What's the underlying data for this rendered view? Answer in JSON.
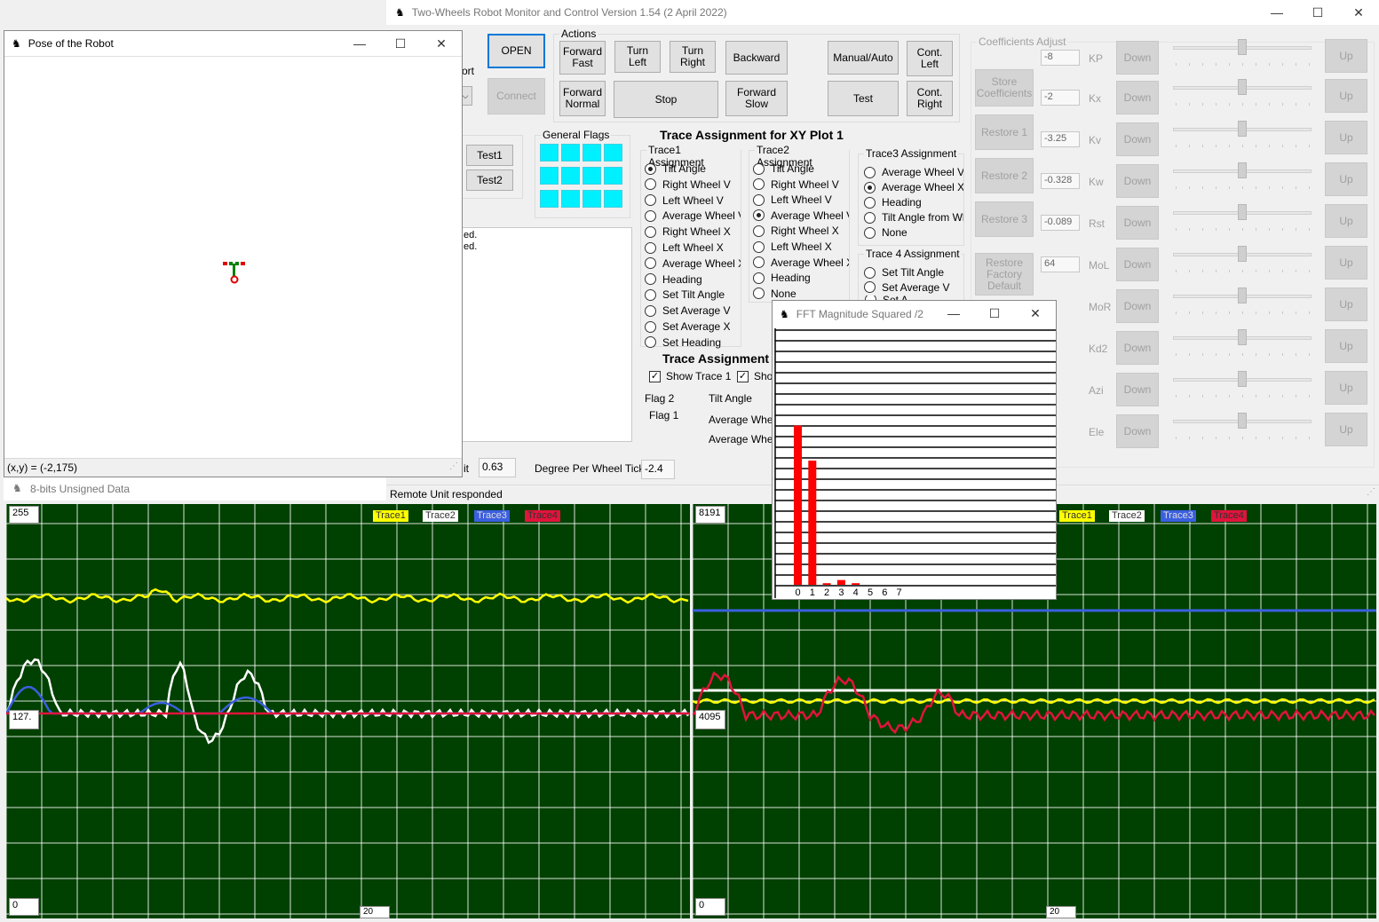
{
  "main_window": {
    "title": "Two-Wheels Robot Monitor and Control Version 1.54 (2 April 2022)",
    "open_label": "OPEN",
    "connect_label": "Connect",
    "port_label": "ort",
    "actions_label": "Actions",
    "actions": {
      "forward_fast": "Forward\nFast",
      "turn_left": "Turn\nLeft",
      "turn_right": "Turn\nRight",
      "backward": "Backward",
      "forward_normal": "Forward\nNormal",
      "stop": "Stop",
      "forward_slow": "Forward\nSlow",
      "manual_auto": "Manual/Auto",
      "cont_left": "Cont.\nLeft",
      "test": "Test",
      "cont_right": "Cont.\nRight"
    },
    "test1": "Test1",
    "test2": "Test2",
    "general_flags": "General Flags",
    "trace_xy_title": "Trace Assignment for XY Plot 1",
    "trace1_title": "Trace1 Assignment",
    "trace1_options": [
      "Tilt Angle",
      "Right Wheel V",
      "Left Wheel V",
      "Average Wheel V",
      "Right Wheel X",
      "Left Wheel X",
      "Average Wheel X",
      "Heading",
      "Set Tilt Angle",
      "Set Average V",
      "Set Average X",
      "Set Heading"
    ],
    "trace2_title": "Trace2 Assignment",
    "trace2_options": [
      "Tilt Angle",
      "Right Wheel V",
      "Left Wheel V",
      "Average Wheel V",
      "Right Wheel X",
      "Left Wheel X",
      "Average Wheel X",
      "Heading",
      "None"
    ],
    "trace3_title": "Trace3 Assignment",
    "trace3_options": [
      "Average Wheel V",
      "Average Wheel X",
      "Heading",
      "Tilt Angle from Whe",
      "None"
    ],
    "trace4_title": "Trace 4 Assignment",
    "trace4_options": [
      "Set Tilt Angle",
      "Set Average V"
    ],
    "trace4_cut": "Set A",
    "trace_assign2_title": "Trace Assignment",
    "show_trace1": "Show Trace 1",
    "show_trace2": "Show",
    "flag2": "Flag 2",
    "flag1": "Flag 1",
    "flag_tilt": "Tilt Angle",
    "flag_avg1": "Average Whee",
    "flag_avg2": "Average Whee",
    "log_line1": "ed.",
    "log_line2": "ed.",
    "hit_label": "it",
    "hit_value": "0.63",
    "degree_label": "Degree Per Wheel Tick",
    "degree_value": "-2.4",
    "status": "Remote Unit responded",
    "coef_title": "Coefficients Adjust",
    "store": "Store\nCoefficients",
    "restore1": "Restore 1",
    "restore2": "Restore 2",
    "restore3": "Restore 3",
    "restore_factory": "Restore\nFactory\nDefault",
    "down": "Down",
    "up": "Up",
    "coeffs": [
      {
        "value": "-8",
        "name": "KP"
      },
      {
        "value": "-2",
        "name": "Kx"
      },
      {
        "value": "-3.25",
        "name": "Kv"
      },
      {
        "value": "-0.328",
        "name": "Kw"
      },
      {
        "value": "-0.089",
        "name": "Rst"
      },
      {
        "value": "64",
        "name": "MoL"
      },
      {
        "value": "",
        "name": "MoR"
      },
      {
        "value": "",
        "name": "Kd2"
      },
      {
        "value": "",
        "name": "Azi"
      },
      {
        "value": "",
        "name": "Ele"
      }
    ]
  },
  "pose_window": {
    "title": "Pose of the Robot",
    "coords": "(x,y) = (-2,175)"
  },
  "data_window": {
    "title": "8-bits Unsigned Data"
  },
  "plot_left": {
    "top": "255",
    "mid": "127.",
    "bottom": "0",
    "x_end": "20"
  },
  "plot_right": {
    "top": "8191",
    "mid": "4095",
    "bottom": "0",
    "x_end": "20"
  },
  "legend": [
    "Trace1",
    "Trace2",
    "Trace3",
    "Trace4"
  ],
  "colors": {
    "trace1": "#ffff00",
    "trace2": "#ffffff",
    "trace3": "#3b5fe0",
    "trace4": "#e0143c",
    "plot_bg": "#004000",
    "flag": "#00f0ff"
  },
  "fft_window": {
    "title": "FFT Magnitude Squared /2",
    "bins": [
      "0",
      "1",
      "2",
      "3",
      "4",
      "5",
      "6",
      "7"
    ]
  },
  "chart_data": {
    "type": "bar",
    "categories": [
      "0",
      "1",
      "2",
      "3",
      "4",
      "5",
      "6",
      "7"
    ],
    "values": [
      100,
      78,
      1,
      3,
      1,
      0,
      0,
      0
    ],
    "ylim": [
      0,
      160
    ],
    "grid": true
  }
}
